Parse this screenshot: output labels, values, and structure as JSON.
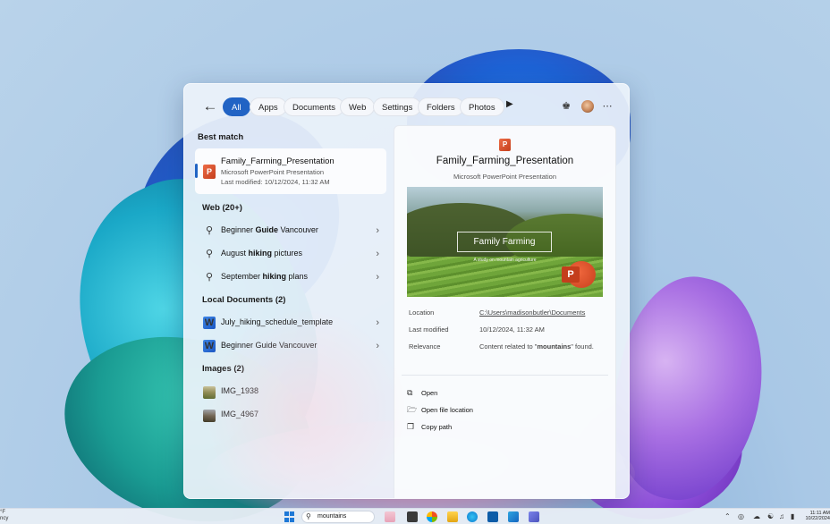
{
  "wallpaper": {
    "accent": "#1f5fcf"
  },
  "search_panel": {
    "back_icon": "arrow-left-icon",
    "filters": [
      "All",
      "Apps",
      "Documents",
      "Web",
      "Settings",
      "Folders",
      "Photos"
    ],
    "active_filter": "All",
    "more_filters_icon": "play-right-icon",
    "trophy_icon": "trophy-icon",
    "avatar_icon": "user-avatar",
    "more_icon": "ellipsis-icon"
  },
  "results": {
    "best_match": {
      "heading": "Best match",
      "name": "Family_Farming_Presentation",
      "type": "Microsoft PowerPoint Presentation",
      "modified": "Last modified: 10/12/2024, 11:32 AM",
      "icon": "powerpoint-icon"
    },
    "web": {
      "heading": "Web (20+)",
      "items": [
        {
          "pre": "Beginner ",
          "bold": "Guide",
          "post": " Vancouver"
        },
        {
          "pre": "August ",
          "bold": "hiking",
          "post": " pictures"
        },
        {
          "pre": "September ",
          "bold": "hiking",
          "post": " plans"
        }
      ]
    },
    "local_documents": {
      "heading": "Local Documents (2)",
      "items": [
        {
          "label": "July_hiking_schedule_template",
          "icon": "word-icon"
        },
        {
          "label": "Beginner Guide Vancouver",
          "icon": "word-icon"
        }
      ]
    },
    "images": {
      "heading": "Images (2)",
      "items": [
        {
          "label": "IMG_1938",
          "icon": "image-thumbnail-icon"
        },
        {
          "label": "IMG_4967",
          "icon": "image-thumbnail-icon"
        }
      ]
    }
  },
  "preview": {
    "title": "Family_Farming_Presentation",
    "subtitle": "Microsoft PowerPoint Presentation",
    "slide_title": "Family Farming",
    "slide_caption": "A study on mountain agriculture",
    "details": {
      "location_label": "Location",
      "location_value": "C:\\Users\\madisonbutler\\Documents",
      "modified_label": "Last modified",
      "modified_value": "10/12/2024, 11:32 AM",
      "relevance_label": "Relevance",
      "relevance_pre": "Content related to \"",
      "relevance_bold": "mountains",
      "relevance_post": "\" found."
    },
    "actions": [
      {
        "label": "Open",
        "icon": "open-external-icon"
      },
      {
        "label": "Open file location",
        "icon": "folder-open-icon"
      },
      {
        "label": "Copy path",
        "icon": "copy-icon"
      }
    ]
  },
  "taskbar": {
    "weather_top": "°F",
    "weather_bottom": "ncy",
    "search_text": "mountains",
    "clock_time": "11:11 AM",
    "clock_date": "10/22/2024"
  }
}
